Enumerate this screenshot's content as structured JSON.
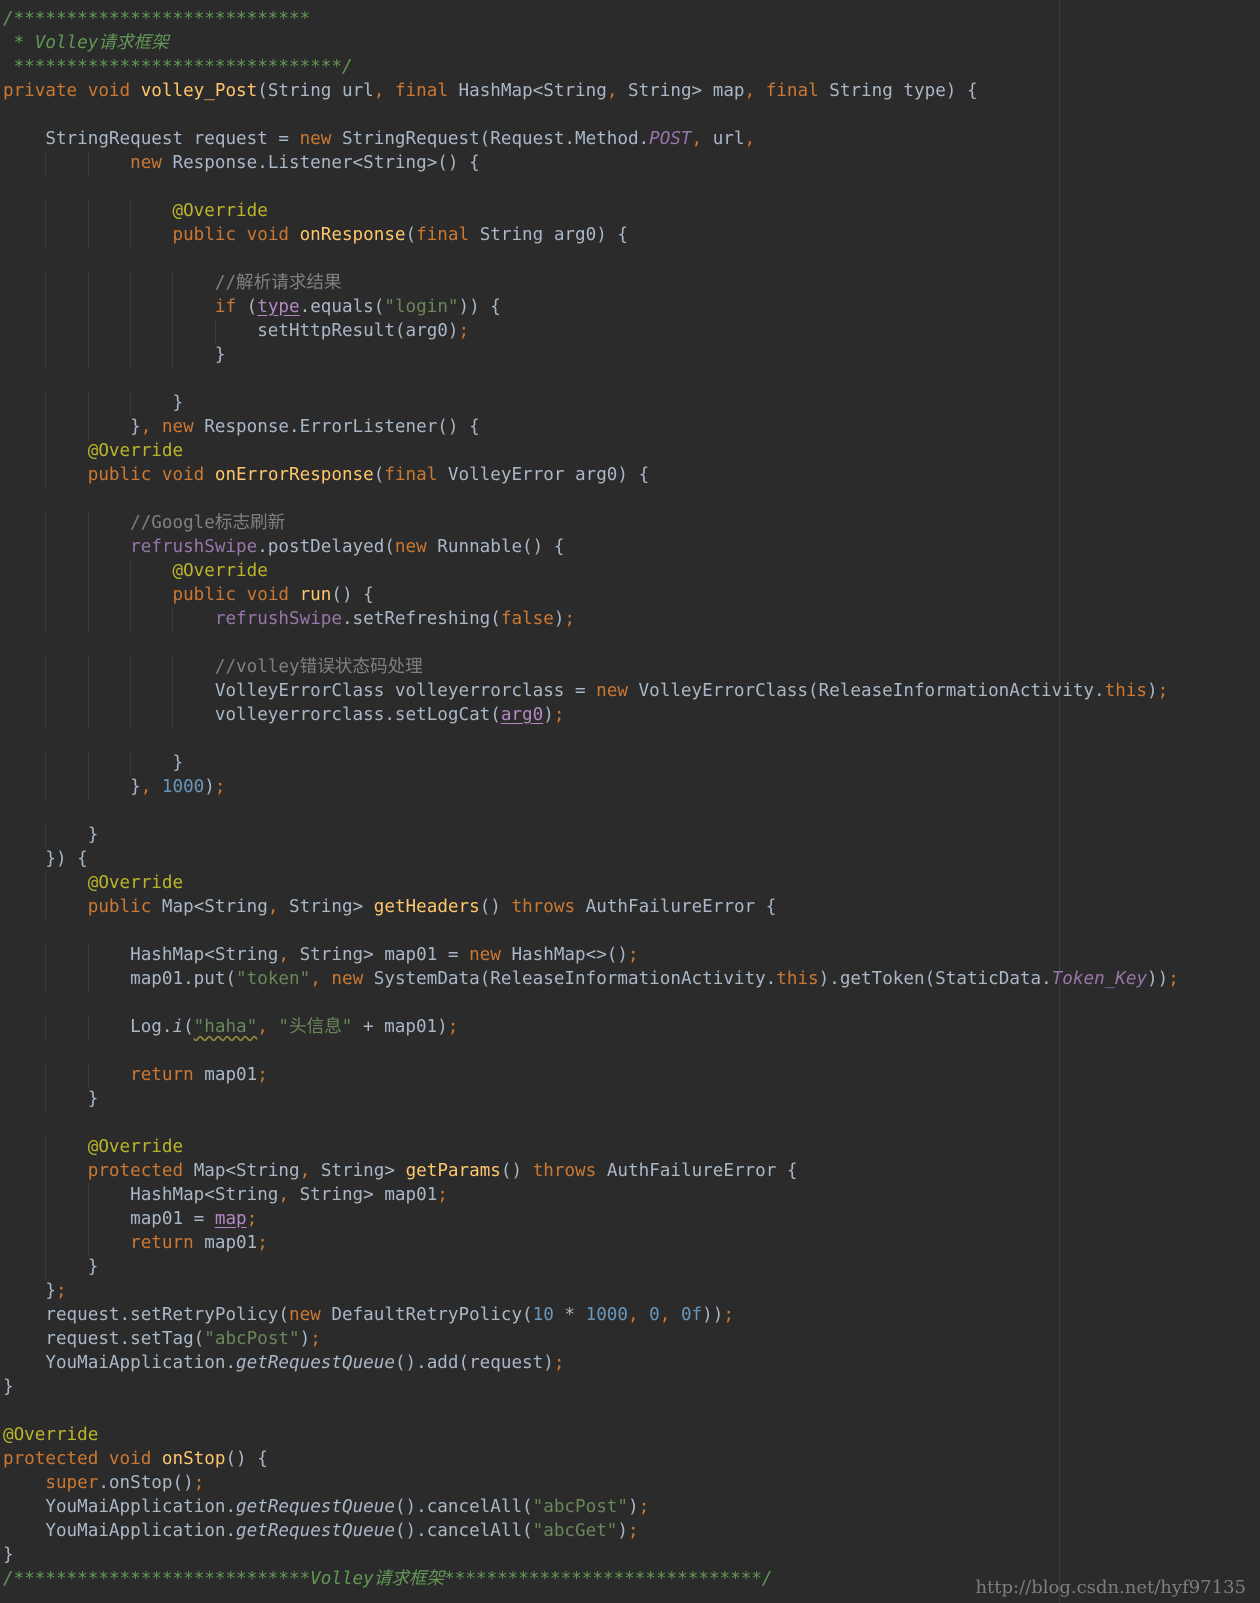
{
  "code": {
    "lines": [
      [
        {
          "t": "/****************************",
          "c": "doc"
        }
      ],
      [
        {
          "t": " * Volley请求框架",
          "c": "doc"
        }
      ],
      [
        {
          "t": " *******************************/",
          "c": "doc"
        }
      ],
      [
        {
          "t": "private void ",
          "c": "kw"
        },
        {
          "t": "volley_Post",
          "c": "fn"
        },
        {
          "t": "(String url"
        },
        {
          "t": ", final ",
          "c": "kw"
        },
        {
          "t": "HashMap<String"
        },
        {
          "t": ", ",
          "c": "kw"
        },
        {
          "t": "String> map"
        },
        {
          "t": ", final ",
          "c": "kw"
        },
        {
          "t": "String type) {"
        }
      ],
      [],
      [
        {
          "t": "    StringRequest request = "
        },
        {
          "t": "new ",
          "c": "kw"
        },
        {
          "t": "StringRequest(Request.Method."
        },
        {
          "t": "POST",
          "c": "sfld"
        },
        {
          "t": ", ",
          "c": "kw"
        },
        {
          "t": "url"
        },
        {
          "t": ",",
          "c": "kw"
        }
      ],
      [
        {
          "t": "            "
        },
        {
          "t": "new ",
          "c": "kw"
        },
        {
          "t": "Response.Listener<String>() {"
        }
      ],
      [],
      [
        {
          "t": "                "
        },
        {
          "t": "@Override",
          "c": "an"
        }
      ],
      [
        {
          "t": "                "
        },
        {
          "t": "public void ",
          "c": "kw"
        },
        {
          "t": "onResponse",
          "c": "fn"
        },
        {
          "t": "("
        },
        {
          "t": "final ",
          "c": "kw"
        },
        {
          "t": "String arg0) {"
        }
      ],
      [],
      [
        {
          "t": "                    "
        },
        {
          "t": "//解析请求结果",
          "c": "cm"
        }
      ],
      [
        {
          "t": "                    "
        },
        {
          "t": "if ",
          "c": "kw"
        },
        {
          "t": "("
        },
        {
          "t": "type",
          "c": "cap"
        },
        {
          "t": ".equals("
        },
        {
          "t": "\"login\"",
          "c": "str"
        },
        {
          "t": ")) {"
        }
      ],
      [
        {
          "t": "                        setHttpResult(arg0)"
        },
        {
          "t": ";",
          "c": "kw"
        }
      ],
      [
        {
          "t": "                    }"
        }
      ],
      [],
      [
        {
          "t": "                }"
        }
      ],
      [
        {
          "t": "            }"
        },
        {
          "t": ", new ",
          "c": "kw"
        },
        {
          "t": "Response.ErrorListener() {"
        }
      ],
      [
        {
          "t": "        "
        },
        {
          "t": "@Override",
          "c": "an"
        }
      ],
      [
        {
          "t": "        "
        },
        {
          "t": "public void ",
          "c": "kw"
        },
        {
          "t": "onErrorResponse",
          "c": "fn"
        },
        {
          "t": "("
        },
        {
          "t": "final ",
          "c": "kw"
        },
        {
          "t": "VolleyError arg0) {"
        }
      ],
      [],
      [
        {
          "t": "            "
        },
        {
          "t": "//Google标志刷新",
          "c": "cm"
        }
      ],
      [
        {
          "t": "            "
        },
        {
          "t": "refrushSwipe",
          "c": "fld"
        },
        {
          "t": ".postDelayed("
        },
        {
          "t": "new ",
          "c": "kw"
        },
        {
          "t": "Runnable() {"
        }
      ],
      [
        {
          "t": "                "
        },
        {
          "t": "@Override",
          "c": "an"
        }
      ],
      [
        {
          "t": "                "
        },
        {
          "t": "public void ",
          "c": "kw"
        },
        {
          "t": "run",
          "c": "fn"
        },
        {
          "t": "() {"
        }
      ],
      [
        {
          "t": "                    "
        },
        {
          "t": "refrushSwipe",
          "c": "fld"
        },
        {
          "t": ".setRefreshing("
        },
        {
          "t": "false",
          "c": "kw"
        },
        {
          "t": ")"
        },
        {
          "t": ";",
          "c": "kw"
        }
      ],
      [],
      [
        {
          "t": "                    "
        },
        {
          "t": "//volley错误状态码处理",
          "c": "cm"
        }
      ],
      [
        {
          "t": "                    VolleyErrorClass volleyerrorclass = "
        },
        {
          "t": "new ",
          "c": "kw"
        },
        {
          "t": "VolleyErrorClass(ReleaseInformationActivity."
        },
        {
          "t": "this",
          "c": "kw"
        },
        {
          "t": ")"
        },
        {
          "t": ";",
          "c": "kw"
        }
      ],
      [
        {
          "t": "                    volleyerrorclass.setLogCat("
        },
        {
          "t": "arg0",
          "c": "cap"
        },
        {
          "t": ")"
        },
        {
          "t": ";",
          "c": "kw"
        }
      ],
      [],
      [
        {
          "t": "                }"
        }
      ],
      [
        {
          "t": "            }"
        },
        {
          "t": ", ",
          "c": "kw"
        },
        {
          "t": "1000",
          "c": "num"
        },
        {
          "t": ")"
        },
        {
          "t": ";",
          "c": "kw"
        }
      ],
      [],
      [
        {
          "t": "        }"
        }
      ],
      [
        {
          "t": "    }) {"
        }
      ],
      [
        {
          "t": "        "
        },
        {
          "t": "@Override",
          "c": "an"
        }
      ],
      [
        {
          "t": "        "
        },
        {
          "t": "public ",
          "c": "kw"
        },
        {
          "t": "Map<String"
        },
        {
          "t": ", ",
          "c": "kw"
        },
        {
          "t": "String> "
        },
        {
          "t": "getHeaders",
          "c": "fn"
        },
        {
          "t": "() "
        },
        {
          "t": "throws ",
          "c": "kw"
        },
        {
          "t": "AuthFailureError {"
        }
      ],
      [],
      [
        {
          "t": "            HashMap<String"
        },
        {
          "t": ", ",
          "c": "kw"
        },
        {
          "t": "String> map01 = "
        },
        {
          "t": "new ",
          "c": "kw"
        },
        {
          "t": "HashMap<>()"
        },
        {
          "t": ";",
          "c": "kw"
        }
      ],
      [
        {
          "t": "            map01.put("
        },
        {
          "t": "\"token\"",
          "c": "str"
        },
        {
          "t": ", new ",
          "c": "kw"
        },
        {
          "t": "SystemData(ReleaseInformationActivity."
        },
        {
          "t": "this",
          "c": "kw"
        },
        {
          "t": ").getToken(StaticData."
        },
        {
          "t": "Token_Key",
          "c": "sfld"
        },
        {
          "t": "))"
        },
        {
          "t": ";",
          "c": "kw"
        }
      ],
      [],
      [
        {
          "t": "            Log."
        },
        {
          "t": "i",
          "c": "smeth"
        },
        {
          "t": "("
        },
        {
          "t": "\"haha\"",
          "c": "str warn"
        },
        {
          "t": ", ",
          "c": "kw"
        },
        {
          "t": "\"头信息\" ",
          "c": "str"
        },
        {
          "t": "+ map01)"
        },
        {
          "t": ";",
          "c": "kw"
        }
      ],
      [],
      [
        {
          "t": "            "
        },
        {
          "t": "return ",
          "c": "kw"
        },
        {
          "t": "map01"
        },
        {
          "t": ";",
          "c": "kw"
        }
      ],
      [
        {
          "t": "        }"
        }
      ],
      [],
      [
        {
          "t": "        "
        },
        {
          "t": "@Override",
          "c": "an"
        }
      ],
      [
        {
          "t": "        "
        },
        {
          "t": "protected ",
          "c": "kw"
        },
        {
          "t": "Map<String"
        },
        {
          "t": ", ",
          "c": "kw"
        },
        {
          "t": "String> "
        },
        {
          "t": "getParams",
          "c": "fn"
        },
        {
          "t": "() "
        },
        {
          "t": "throws ",
          "c": "kw"
        },
        {
          "t": "AuthFailureError {"
        }
      ],
      [
        {
          "t": "            HashMap<String"
        },
        {
          "t": ", ",
          "c": "kw"
        },
        {
          "t": "String> map01"
        },
        {
          "t": ";",
          "c": "kw"
        }
      ],
      [
        {
          "t": "            map01 = "
        },
        {
          "t": "map",
          "c": "cap"
        },
        {
          "t": ";",
          "c": "kw"
        }
      ],
      [
        {
          "t": "            "
        },
        {
          "t": "return ",
          "c": "kw"
        },
        {
          "t": "map01"
        },
        {
          "t": ";",
          "c": "kw"
        }
      ],
      [
        {
          "t": "        }"
        }
      ],
      [
        {
          "t": "    }"
        },
        {
          "t": ";",
          "c": "kw"
        }
      ],
      [
        {
          "t": "    request.setRetryPolicy("
        },
        {
          "t": "new ",
          "c": "kw"
        },
        {
          "t": "DefaultRetryPolicy("
        },
        {
          "t": "10 ",
          "c": "num"
        },
        {
          "t": "* "
        },
        {
          "t": "1000",
          "c": "num"
        },
        {
          "t": ", ",
          "c": "kw"
        },
        {
          "t": "0",
          "c": "num"
        },
        {
          "t": ", ",
          "c": "kw"
        },
        {
          "t": "0f",
          "c": "num"
        },
        {
          "t": "))"
        },
        {
          "t": ";",
          "c": "kw"
        }
      ],
      [
        {
          "t": "    request.setTag("
        },
        {
          "t": "\"abcPost\"",
          "c": "str"
        },
        {
          "t": ")"
        },
        {
          "t": ";",
          "c": "kw"
        }
      ],
      [
        {
          "t": "    YouMaiApplication."
        },
        {
          "t": "getRequestQueue",
          "c": "smeth"
        },
        {
          "t": "().add(request)"
        },
        {
          "t": ";",
          "c": "kw"
        }
      ],
      [
        {
          "t": "}"
        }
      ],
      [],
      [
        {
          "t": "@Override",
          "c": "an"
        }
      ],
      [
        {
          "t": "protected void ",
          "c": "kw"
        },
        {
          "t": "onStop",
          "c": "fn"
        },
        {
          "t": "() {"
        }
      ],
      [
        {
          "t": "    "
        },
        {
          "t": "super",
          "c": "kw"
        },
        {
          "t": ".onStop()"
        },
        {
          "t": ";",
          "c": "kw"
        }
      ],
      [
        {
          "t": "    YouMaiApplication."
        },
        {
          "t": "getRequestQueue",
          "c": "smeth"
        },
        {
          "t": "().cancelAll("
        },
        {
          "t": "\"abcPost\"",
          "c": "str"
        },
        {
          "t": ")"
        },
        {
          "t": ";",
          "c": "kw"
        }
      ],
      [
        {
          "t": "    YouMaiApplication."
        },
        {
          "t": "getRequestQueue",
          "c": "smeth"
        },
        {
          "t": "().cancelAll("
        },
        {
          "t": "\"abcGet\"",
          "c": "str"
        },
        {
          "t": ")"
        },
        {
          "t": ";",
          "c": "kw"
        }
      ],
      [
        {
          "t": "}"
        }
      ],
      [
        {
          "t": "/****************************Volley请求框架******************************/",
          "c": "doc"
        }
      ]
    ]
  },
  "watermark": "http://blog.csdn.net/hyf97135",
  "colors": {
    "background": "#2b2b2b",
    "default_text": "#a9b7c6",
    "keyword": "#cc7832",
    "method_declaration": "#ffc66d",
    "annotation": "#bbb529",
    "string": "#6a8759",
    "number": "#6897bb",
    "comment": "#808080",
    "doc_comment": "#629755",
    "field": "#9876aa"
  }
}
